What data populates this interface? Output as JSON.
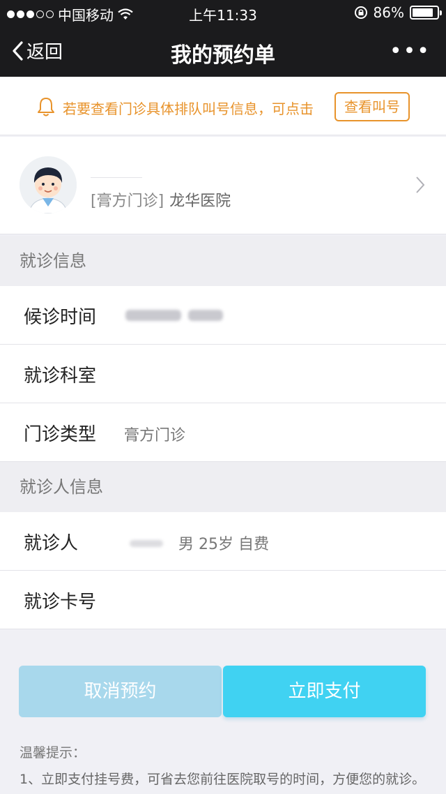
{
  "status_bar": {
    "carrier": "中国移动",
    "time": "上午11:33",
    "battery_text": "86%",
    "battery_level": 0.86
  },
  "nav": {
    "back_label": "返回",
    "title": "我的预约单",
    "more_label": "•••"
  },
  "notice": {
    "text": "若要查看门诊具体排队叫号信息，可点击",
    "button_label": "查看叫号",
    "accent_color": "#e8932b"
  },
  "patient_card": {
    "clinic_type": "[膏方门诊]",
    "hospital": "龙华医院"
  },
  "visit_section": {
    "title": "就诊信息",
    "rows": [
      {
        "label": "候诊时间",
        "value": ""
      },
      {
        "label": "就诊科室",
        "value": ""
      },
      {
        "label": "门诊类型",
        "value": "膏方门诊"
      }
    ]
  },
  "patient_section": {
    "title": "就诊人信息",
    "rows": [
      {
        "label": "就诊人",
        "value": "男 25岁 自费"
      },
      {
        "label": "就诊卡号",
        "value": ""
      }
    ]
  },
  "actions": {
    "cancel_label": "取消预约",
    "pay_label": "立即支付",
    "pay_color": "#40d2f2",
    "cancel_color": "#a8d8ec"
  },
  "tips": {
    "title": "温馨提示：",
    "text": "1、立即支付挂号费，可省去您前往医院取号的时间，方便您的就诊。"
  }
}
